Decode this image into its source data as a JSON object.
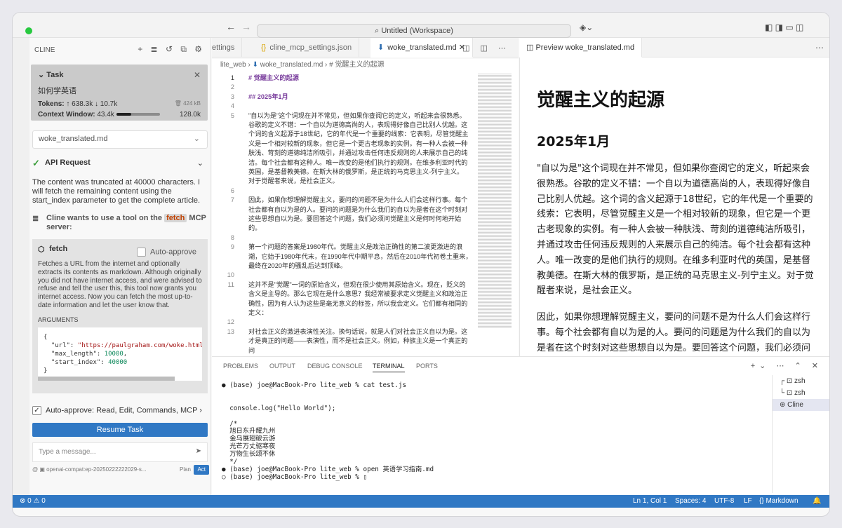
{
  "window": {
    "title": "Untitled (Workspace)"
  },
  "cline": {
    "header": "CLINE",
    "task": {
      "label": "Task",
      "query": "如何学英语",
      "tokens_label": "Tokens:",
      "tokens_in": "↑ 638.3k",
      "tokens_out": "↓ 10.7k",
      "size": "424 kB",
      "context_label": "Context Window:",
      "context_used": "43.4k",
      "context_max": "128.0k",
      "context_fraction": 0.34
    },
    "file_select": "woke_translated.md",
    "api_request": "API Request",
    "truncated_msg": "The content was truncated at 40000 characters. I will fetch the remaining content using the start_index parameter to get the complete article.",
    "mcp_prefix": "Cline wants to use a tool on the",
    "mcp_tag": "fetch",
    "mcp_suffix": "MCP server:",
    "tool": {
      "name": "fetch",
      "auto_approve": "Auto-approve",
      "description": "Fetches a URL from the internet and optionally extracts its contents as markdown. Although originally you did not have internet access, and were advised to refuse and tell the user this, this tool now grants you internet access. Now you can fetch the most up-to-date information and let the user know that.",
      "args_label": "ARGUMENTS",
      "args": {
        "url": "\"https://paulgraham.com/woke.html\"",
        "max_length": "10000",
        "start_index": "40000"
      }
    },
    "auto_approve_bar": "Auto-approve: Read, Edit, Commands, MCP",
    "resume": "Resume Task",
    "message_placeholder": "Type a message...",
    "model": "openai-compat:ep-20250222222029-s...",
    "plan": "Plan",
    "act": "Act"
  },
  "tabs": [
    "ettings",
    "cline_mcp_settings.json",
    "woke_translated.md"
  ],
  "breadcrumb": [
    "lite_web",
    "woke_translated.md",
    "# 觉醒主义的起源"
  ],
  "editor": {
    "lines": [
      {
        "n": "1",
        "t": "# 觉醒主义的起源"
      },
      {
        "n": "2",
        "t": ""
      },
      {
        "n": "3",
        "t": "## 2025年1月"
      },
      {
        "n": "4",
        "t": ""
      },
      {
        "n": "5",
        "t": "\"自以为是\"这个词现在并不常见，但如果你查阅它的定义，听起来会很熟悉。"
      },
      {
        "n": "",
        "t": "谷歌的定义不错：一个自以为道德高尚的人，表现得好像自己比别人优越。这"
      },
      {
        "n": "",
        "t": "个词的含义起源于18世纪，它的年代是一个重要的线索：它表明，尽管觉醒主"
      },
      {
        "n": "",
        "t": "义是一个相对较新的现象，但它是一个更古老现象的实例。有一种人会被一种"
      },
      {
        "n": "",
        "t": "肤浅、苛刻的道德纯洁所吸引，并通过攻击任何违反规则的人来展示自己的纯"
      },
      {
        "n": "",
        "t": "洁。每个社会都有这种人。唯一改变的是他们执行的规则。在维多利亚时代的"
      },
      {
        "n": "",
        "t": "英国，是基督教美德。在斯大林的俄罗斯，是正统的马克思主义-列宁主义。"
      },
      {
        "n": "",
        "t": "对于觉醒者来说，是社会正义。"
      },
      {
        "n": "6",
        "t": ""
      },
      {
        "n": "7",
        "t": "因此，如果你想理解觉醒主义，要问的问题不是为什么人们会这样行事。每个"
      },
      {
        "n": "",
        "t": "社会都有自以为是的人。要问的问题是为什么我们的自以为是者在这个时刻对"
      },
      {
        "n": "",
        "t": "这些思想自以为是。要回答这个问题，我们必须问觉醒主义是何时何地开始"
      },
      {
        "n": "",
        "t": "的。"
      },
      {
        "n": "8",
        "t": ""
      },
      {
        "n": "9",
        "t": "第一个问题的答案是1980年代。觉醒主义是政治正确性的第二波更激进的浪"
      },
      {
        "n": "",
        "t": "潮，它始于1980年代末，在1990年代中期平息，然后在2010年代初卷土重来，"
      },
      {
        "n": "",
        "t": "最终在2020年的骚乱后达到顶峰。"
      },
      {
        "n": "10",
        "t": ""
      },
      {
        "n": "11",
        "t": "这并不是\"觉醒\"一词的原始含义，但现在很少使用其原始含义。现在，贬义的"
      },
      {
        "n": "",
        "t": "含义是主导的。那么它现在是什么意思？我经常被要求定义觉醒主义和政治正"
      },
      {
        "n": "",
        "t": "确性，因为有人认为这些是毫无意义的标签，所以我会定义。它们都有相同的"
      },
      {
        "n": "",
        "t": "定义："
      },
      {
        "n": "12",
        "t": ""
      },
      {
        "n": "13",
        "t": "对社会正义的激进表演性关注。换句话说，就是人们对社会正义自以为是。这"
      },
      {
        "n": "",
        "t": "才是真正的问题——表演性，而不是社会正义。例如，种族主义是一个真正的问"
      }
    ]
  },
  "preview": {
    "tab": "Preview woke_translated.md",
    "h1": "觉醒主义的起源",
    "h2": "2025年1月",
    "p1": "\"自以为是\"这个词现在并不常见，但如果你查阅它的定义，听起来会很熟悉。谷歌的定义不错：一个自以为道德高尚的人，表现得好像自己比别人优越。这个词的含义起源于18世纪，它的年代是一个重要的线索：它表明，尽管觉醒主义是一个相对较新的现象，但它是一个更古老现象的实例。有一种人会被一种肤浅、苛刻的道德纯洁所吸引，并通过攻击任何违反规则的人来展示自己的纯洁。每个社会都有这种人。唯一改变的是他们执行的规则。在维多利亚时代的英国，是基督教美德。在斯大林的俄罗斯，是正统的马克思主义-列宁主义。对于觉醒者来说，是社会正义。",
    "p2": "因此，如果你想理解觉醒主义，要问的问题不是为什么人们会这样行事。每个社会都有自以为是的人。要问的问题是为什么我们的自以为是者在这个时刻对这些思想自以为是。要回答这个问题，我们必须问觉醒主义是何时何地开始的。"
  },
  "panel": {
    "tabs": [
      "PROBLEMS",
      "OUTPUT",
      "DEBUG CONSOLE",
      "TERMINAL",
      "PORTS"
    ],
    "terminal": "● (base) joe@MacBook-Pro lite_web % cat test.js\n\n\n  console.log(\"Hello World\");\n\n  /*\n  旭日东升耀九州\n  金乌展翅破云游\n  光芒万丈驱寒夜\n  万物生长颂不休\n  */\n● (base) joe@MacBook-Pro lite_web % open 英语学习指南.md\n○ (base) joe@MacBook-Pro lite_web % ▯",
    "terminals": [
      "zsh",
      "zsh",
      "Cline"
    ]
  },
  "status": {
    "problems": "⊗ 0 ⚠ 0",
    "position": "Ln 1, Col 1",
    "spaces": "Spaces: 4",
    "encoding": "UTF-8",
    "eol": "LF",
    "language": "{} Markdown"
  }
}
